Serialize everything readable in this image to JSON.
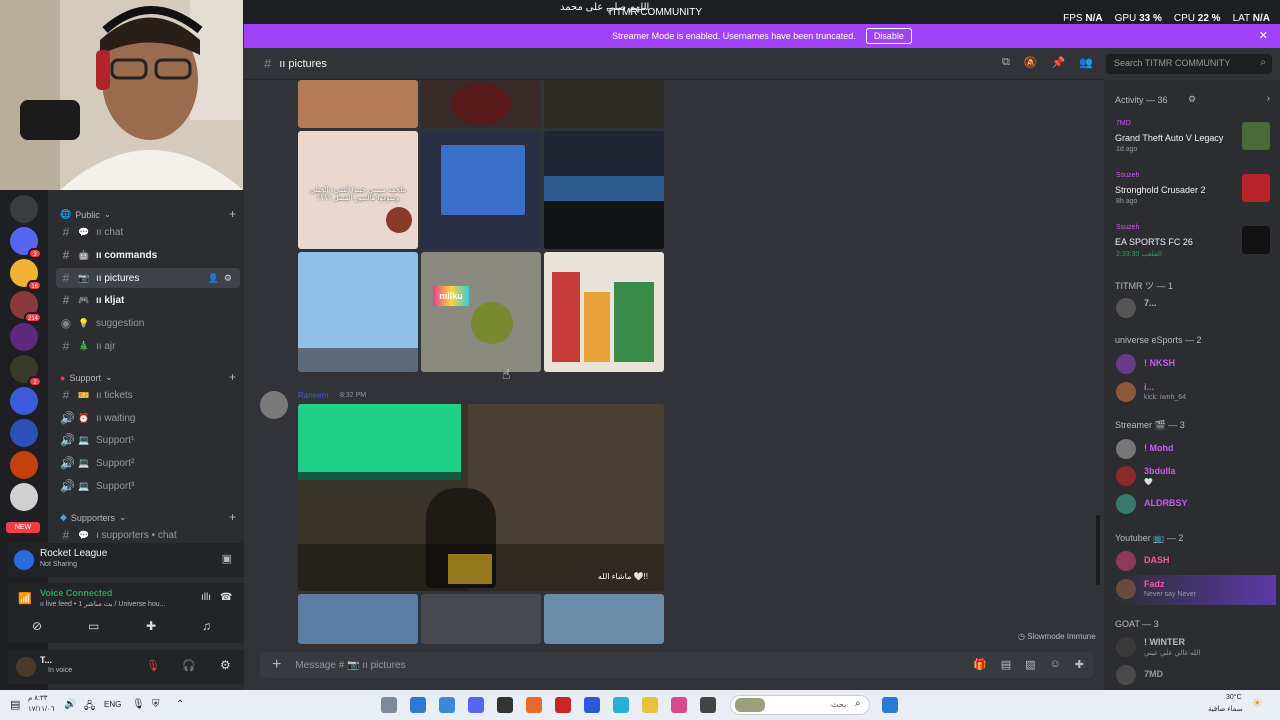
{
  "overlay": {
    "title": "TITMR COMMUNITY",
    "arabic_banner": "اللهم صلي على محمد",
    "stats": [
      {
        "label": "FPS",
        "value": "N/A"
      },
      {
        "label": "GPU",
        "value": "33 %"
      },
      {
        "label": "CPU",
        "value": "22 %"
      },
      {
        "label": "LAT",
        "value": "N/A"
      }
    ]
  },
  "streamer_mode": {
    "text": "Streamer Mode is enabled. Usernames have been truncated.",
    "button": "Disable",
    "color": "#a042f5"
  },
  "sidebar": {
    "categories": [
      {
        "label": "Public",
        "channels": [
          {
            "emoji": "💬",
            "label": "ıı chat"
          },
          {
            "emoji": "🤖",
            "label": "ıı commands"
          },
          {
            "emoji": "📷",
            "label": "ıı pictures"
          },
          {
            "emoji": "🎮",
            "label": "ıı kljat"
          },
          {
            "emoji": "💡",
            "label": "suggestion"
          },
          {
            "emoji": "🎄",
            "label": "ıı ajr"
          }
        ]
      },
      {
        "label": "Support",
        "channels": [
          {
            "emoji": "🎫",
            "label": "ıı tickets"
          },
          {
            "emoji": "⏰",
            "label": "ıı waiting"
          },
          {
            "emoji": "💻",
            "label": "Support¹"
          },
          {
            "emoji": "💻",
            "label": "Support²"
          },
          {
            "emoji": "💻",
            "label": "Support³"
          }
        ]
      },
      {
        "label": "Supporters",
        "channels": [
          {
            "emoji": "💬",
            "label": "ı supporters • chat"
          }
        ]
      }
    ],
    "server_badges": [
      "3",
      "16",
      "214",
      "2"
    ],
    "new_label": "NEW"
  },
  "activity_panel": {
    "game": "Rocket League",
    "status": "Not Sharing"
  },
  "voice_panel": {
    "title": "Voice Connected",
    "channel": "ıı live feed • بث مباشر 1 / Universe hou..."
  },
  "user_panel": {
    "name": "T...",
    "status": "In voice"
  },
  "chat": {
    "channel": "ıı pictures",
    "message_author": "Raneem",
    "message_time": "8:32 PM",
    "image_texts": {
      "caption1": "ملحمة ميسي جبتوا الشيء الخيلي وشوفوا هالصور الفضل ؟؟؟؟",
      "caption2": "ماشاء الله 🤍!!",
      "milku": "milku"
    },
    "slowmode": "Slowmode Immune",
    "composer_placeholder": "Message # 📷 ıı pictures"
  },
  "search": {
    "placeholder": "Search TITMR COMMUNITY"
  },
  "members": {
    "activity_header": "Activity — 36",
    "activities": [
      {
        "user": "7MD",
        "game": "Grand Theft Auto V Legacy",
        "time": "1d ago"
      },
      {
        "user": "Ssuzeh",
        "game": "Stronghold Crusader 2",
        "time": "8h ago"
      },
      {
        "user": "Ssuzeh",
        "game": "EA SPORTS FC 26",
        "time": "2:33:30 الملعب"
      }
    ],
    "sections": [
      {
        "title": "TITMR ツ — 1",
        "members": [
          {
            "name": "7...",
            "status": "",
            "color": "#b5bac1"
          }
        ]
      },
      {
        "title": "universe eSports — 2",
        "members": [
          {
            "name": "! NKSH",
            "status": "",
            "color": "#c95cf2"
          },
          {
            "name": "i...",
            "status": "kick: iwnh_64",
            "color": "#c95cf2"
          }
        ]
      },
      {
        "title": "Streamer 🎬 — 3",
        "members": [
          {
            "name": "! Mohd",
            "status": "",
            "color": "#c95cf2"
          },
          {
            "name": "3bdulla",
            "status": "🤍",
            "color": "#c95cf2"
          },
          {
            "name": "ALDRBSY",
            "status": "",
            "color": "#c95cf2"
          }
        ]
      },
      {
        "title": "Youtuber 📺 — 2",
        "members": [
          {
            "name": "DASH",
            "status": "",
            "color": "#f25c9e"
          },
          {
            "name": "Fadz",
            "status": "Never say Never",
            "color": "#f25c9e"
          }
        ]
      },
      {
        "title": "GOAT — 3",
        "members": [
          {
            "name": "! WINTER",
            "status": "الله غالي علي عيني",
            "color": "#b5bac1"
          },
          {
            "name": "7MD",
            "status": "",
            "color": "#b5bac1"
          }
        ]
      }
    ]
  },
  "taskbar": {
    "left_time": "٨:٣٣ م",
    "left_date": "١٧/١١/٠٦",
    "lang": "ENG",
    "search_placeholder": "بحث",
    "weather_temp": "30°C",
    "weather_desc": "سماء صافية"
  }
}
